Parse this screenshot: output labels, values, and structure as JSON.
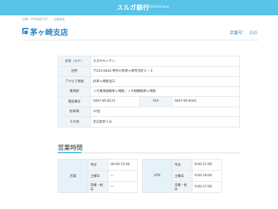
{
  "header": {
    "logo": "スルガ銀行",
    "logo_sub": "SURUGA bank"
  },
  "breadcrumb": [
    "店舗・ATM検索TOP",
    "店舗検索"
  ],
  "page": {
    "title": "茅ヶ崎支店",
    "store_no_label": "店番号：",
    "store_no": "310"
  },
  "info": [
    {
      "label": "名称（カナ）",
      "value": "チガサキシテン"
    },
    {
      "label": "住所",
      "value": "〒253-0043 神奈川県茅ヶ崎市元町２－３"
    },
    {
      "label": "アクセス情報",
      "value": "JR茅ヶ崎駅北口"
    },
    {
      "label": "最寄駅",
      "value": "ＪＲ東海道線茅ヶ崎駅／ＪＲ相模線茅ヶ崎駅"
    },
    {
      "label": "電話番号",
      "value": "0467-85-8121",
      "label2": "FAX",
      "value2": "0467-85-8341"
    },
    {
      "label": "駐車場",
      "value": "10台"
    },
    {
      "label": "その他",
      "value": "北口徒歩１分"
    }
  ],
  "hours": {
    "title": "営業時間",
    "branch": {
      "head": "店舗",
      "rows": [
        {
          "day": "平日",
          "time": "09:00-15:00"
        },
        {
          "day": "土曜日",
          "time": "―"
        },
        {
          "day": "日曜・祝日",
          "time": "―"
        }
      ]
    },
    "atm": {
      "head": "ATM",
      "rows": [
        {
          "day": "平日",
          "time": "8:00-21:00"
        },
        {
          "day": "土曜日",
          "time": "9:00-19:00"
        },
        {
          "day": "日曜・祝日",
          "time": "9:00-17:00"
        }
      ]
    }
  },
  "colors": {
    "header": "#59c3e8",
    "accent": "#2f86c4"
  }
}
